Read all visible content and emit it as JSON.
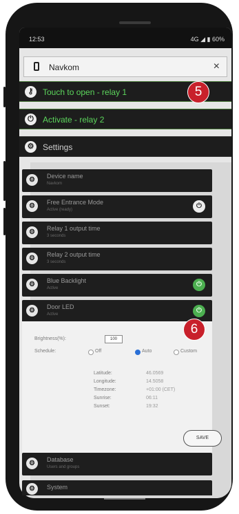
{
  "status_bar": {
    "time": "12:53",
    "indicators": "4G ◢ ▮ 60%"
  },
  "header": {
    "title": "Navkom",
    "close_glyph": "×"
  },
  "actions": [
    {
      "label": "Touch to open - relay 1",
      "icon": "key-icon",
      "glyph": "⚷",
      "color": "green"
    },
    {
      "label": "Activate - relay 2",
      "icon": "power-icon",
      "glyph": "⏻",
      "color": "green"
    },
    {
      "label": "Settings",
      "icon": "gear-icon",
      "glyph": "⚙",
      "color": "grey"
    }
  ],
  "badges": {
    "first": "5",
    "second": "6"
  },
  "settings_items": [
    {
      "name": "Device name",
      "sub": "Navkom",
      "icon": "gear-icon",
      "toggle": ""
    },
    {
      "name": "Free Entrance Mode",
      "sub": "Active (ready)",
      "icon": "gear-icon",
      "toggle": "white"
    },
    {
      "name": "Relay 1 output time",
      "sub": "3 seconds",
      "icon": "gear-icon",
      "toggle": ""
    },
    {
      "name": "Relay 2 output time",
      "sub": "3 seconds",
      "icon": "gear-icon",
      "toggle": ""
    },
    {
      "name": "Blue Backlight",
      "sub": "Active",
      "icon": "gear-icon",
      "toggle": "green"
    },
    {
      "name": "Door LED",
      "sub": "Active",
      "icon": "gear-icon",
      "toggle": "green"
    }
  ],
  "led_settings": {
    "brightness_label": "Brightness(%):",
    "brightness_value": "100",
    "schedule_label": "Schedule:",
    "options": [
      {
        "label": "Off",
        "selected": false
      },
      {
        "label": "Auto",
        "selected": true
      },
      {
        "label": "Custom",
        "selected": false
      }
    ],
    "rows": [
      {
        "key": "Latitude:",
        "value": "46.0569"
      },
      {
        "key": "Longitude:",
        "value": "14.5058"
      },
      {
        "key": "Timezone:",
        "value": "+01:00 (CET)"
      },
      {
        "key": "Sunrise:",
        "value": "06:11"
      },
      {
        "key": "Sunset:",
        "value": "19:32"
      }
    ],
    "save_label": "SAVE"
  },
  "bottom_items": [
    {
      "name": "Database",
      "sub": "Users and groups",
      "icon": "gear-icon"
    },
    {
      "name": "System",
      "sub": "",
      "icon": "gear-icon"
    }
  ],
  "colors": {
    "accent_green": "#5cd65c",
    "toggle_green": "#4caf50",
    "badge_red": "#c8202b",
    "radio_blue": "#2a6fd6"
  }
}
